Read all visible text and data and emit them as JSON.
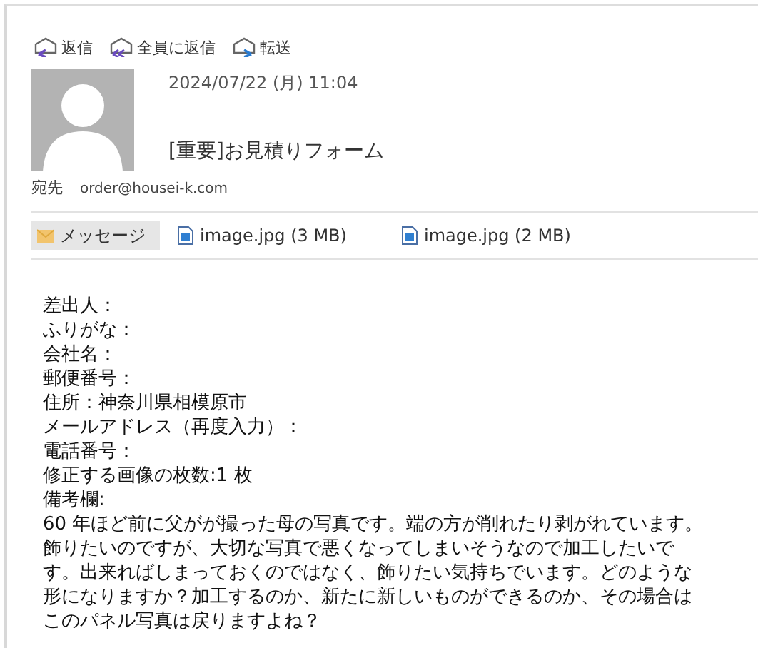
{
  "actions": [
    {
      "kind": "reply",
      "label": "返信"
    },
    {
      "kind": "reply_all",
      "label": "全員に返信"
    },
    {
      "kind": "forward",
      "label": "転送"
    }
  ],
  "message": {
    "date": "2024/07/22 (月) 11:04",
    "subject": "[重要]お見積りフォーム",
    "to_label": "宛先",
    "to": "order@housei-k.com"
  },
  "tabs": [
    {
      "kind": "message",
      "label": "メッセージ",
      "selected": true
    },
    {
      "kind": "file",
      "label": "image.jpg (3 MB)",
      "selected": false
    },
    {
      "kind": "file",
      "label": "image.jpg (2 MB)",
      "selected": false
    }
  ],
  "body": [
    "差出人：",
    "ふりがな：",
    "会社名：",
    "郵便番号：",
    "住所：神奈川県相模原市",
    "メールアドレス（再度入力）：",
    "電話番号：",
    "修正する画像の枚数:1 枚",
    "備考欄:",
    "60 年ほど前に父がが撮った母の写真です。端の方が削れたり剥がれています。",
    "飾りたいのですが、大切な写真で悪くなってしまいそうなので加工したいで",
    "す。出来ればしまっておくのではなく、飾りたい気持ちでいます。どのような",
    "形になりますか？加工するのか、新たに新しいものができるのか、その場合は",
    "このパネル写真は戻りますよね？"
  ]
}
